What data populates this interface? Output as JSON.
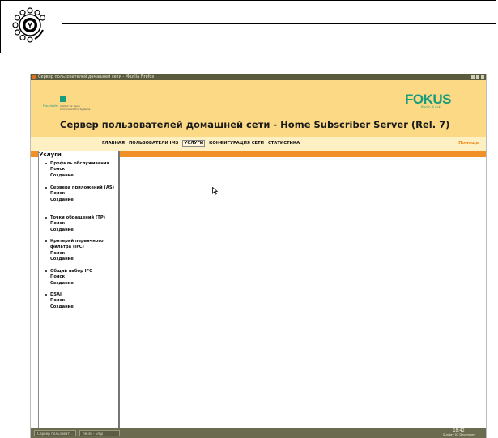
{
  "window": {
    "title": "Сервер пользователей домашней сети - Mozilla Firefox"
  },
  "header": {
    "fraunhofer_name": "Fraunhofer",
    "fraunhofer_institute": "Institut für Open Communication Systems",
    "fokus_logo": "FOKUS",
    "fokus_sub": "Berlin Kursk",
    "page_title": "Сервер пользователей домашней сети - Home Subscriber Server (Rel. 7)"
  },
  "nav": {
    "items": [
      "ГЛАВНАЯ",
      "ПОЛЬЗОВАТЕЛИ IMS",
      "УСЛУГИ",
      "КОНФИГУРАЦИЯ СЕТИ",
      "СТАТИСТИКА"
    ],
    "active": "УСЛУГИ",
    "help": "Помощь"
  },
  "sidebar": {
    "heading": "Услуги",
    "sections": [
      {
        "title": "Профиль обслуживания",
        "links": [
          "Поиск",
          "Создание"
        ]
      },
      {
        "title": "Сервера приложений (AS)",
        "links": [
          "Поиск",
          "Создание"
        ]
      },
      {
        "title": "Точки обращений (TP)",
        "links": [
          "Поиск",
          "Создание"
        ]
      },
      {
        "title": "Критерий первичного фильтра (IFC)",
        "links": [
          "Поиск",
          "Создание"
        ]
      },
      {
        "title": "Общий набор IFC",
        "links": [
          "Поиск",
          "Создание"
        ]
      },
      {
        "title": "DSAI",
        "links": [
          "Поиск",
          "Создание"
        ]
      }
    ]
  },
  "taskbar": {
    "buttons": [
      "Сервер пользоват...",
      "fie.ini - Emp"
    ],
    "time": "18:42",
    "date": "Sunday 07 December"
  },
  "icons": {
    "logo": "rotary-dial-icon",
    "cursor": "mouse-pointer-icon"
  },
  "colors": {
    "header_bg": "#fbd985",
    "nav_bg": "#fff0c4",
    "accent_orange": "#f29028",
    "fokus_green": "#179c7d",
    "taskbar": "#6b6b50"
  }
}
